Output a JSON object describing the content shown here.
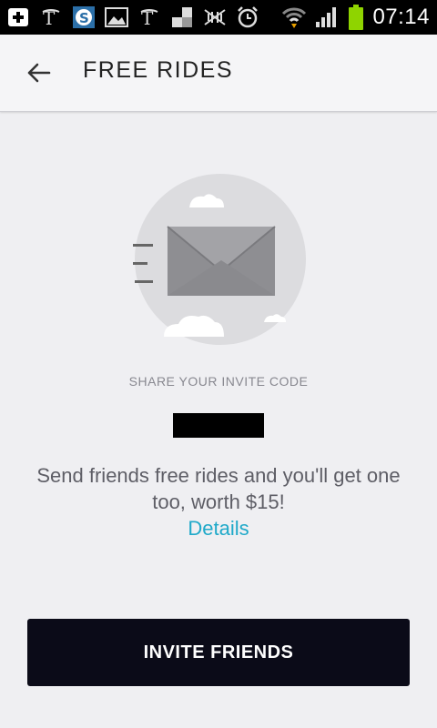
{
  "status_bar": {
    "time": "07:14",
    "icons": [
      "add-icon",
      "nyt-icon",
      "skype-icon",
      "image-icon",
      "nyt-icon",
      "flipboard-icon",
      "mute-icon",
      "alarm-icon",
      "wifi-icon",
      "signal-icon",
      "battery-icon"
    ]
  },
  "header": {
    "title": "FREE RIDES",
    "back_icon": "arrow-left-icon"
  },
  "main": {
    "illustration": "envelope-icon",
    "share_label": "SHARE YOUR INVITE CODE",
    "invite_code": "",
    "description": "Send friends free rides and you'll get one too, worth $15!",
    "details_link": "Details",
    "invite_button": "INVITE FRIENDS"
  },
  "colors": {
    "accent": "#1fa9c9",
    "button_bg": "#0b0b18",
    "background": "#efeff2"
  }
}
